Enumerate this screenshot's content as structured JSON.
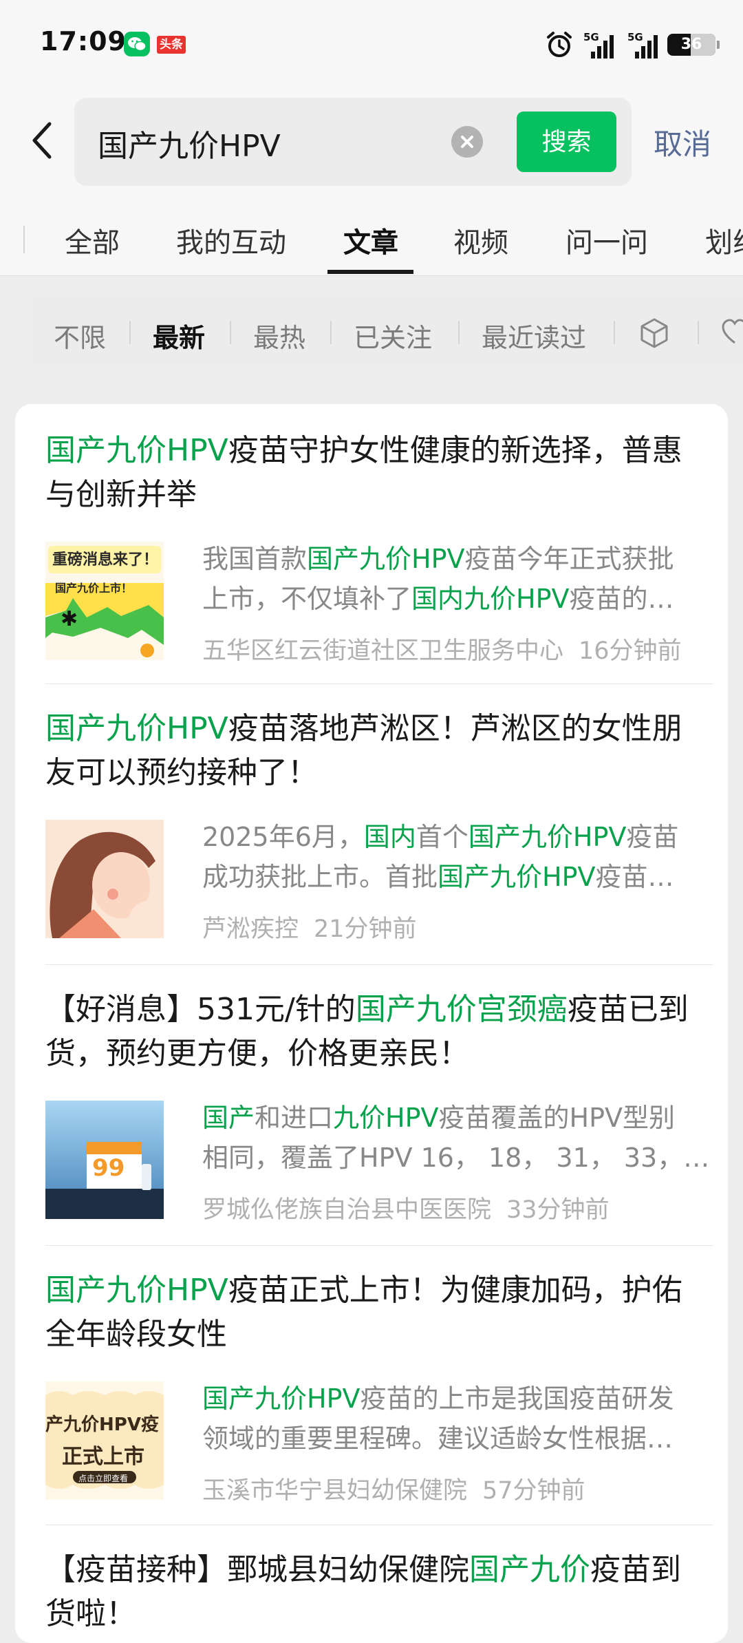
{
  "status_bar": {
    "time": "17:09",
    "toutiao_label": "头条",
    "signal1_label": "5G",
    "signal2_label": "5G",
    "battery": "36",
    "icons": [
      "wechat-icon",
      "toutiao-icon",
      "alarm-icon",
      "signal-icon",
      "battery-icon"
    ]
  },
  "search": {
    "query": "国产九价HPV",
    "search_button": "搜索",
    "cancel": "取消"
  },
  "tabs": {
    "items": [
      "全部",
      "我的互动",
      "文章",
      "视频",
      "问一问",
      "划线"
    ],
    "active": "文章"
  },
  "filters": {
    "items": [
      "不限",
      "最新",
      "最热",
      "已关注",
      "最近读过"
    ],
    "active": "最新",
    "icons": [
      "cube-icon",
      "heart-icon"
    ]
  },
  "results": [
    {
      "title": [
        "国产九价HPV",
        "疫苗守护女性健康的新选择，普惠与创新并举"
      ],
      "snippet_line1": [
        "我国首款",
        "国产九价HPV",
        "疫苗今年正式获批"
      ],
      "snippet_line2": [
        "上市，不仅填补了",
        "国内九价HPV",
        "疫苗的…"
      ],
      "source": "五华区红云街道社区卫生服务中心",
      "time": "16分钟前",
      "thumb_text1": "重磅消息来了！",
      "thumb_text2": "国产九价上市！"
    },
    {
      "title": [
        "国产九价HPV",
        "疫苗落地芦淞区！芦淞区的女性朋友可以预约接种了！"
      ],
      "snippet_line1": [
        "2025年6月，",
        "国内",
        "首个",
        "国产九价HPV",
        "疫苗"
      ],
      "snippet_line2": [
        "成功获批上市。首批",
        "国产九价HPV",
        "疫苗…"
      ],
      "source": "芦淞疾控",
      "time": "21分钟前"
    },
    {
      "title": [
        "【好消息】531元/针的",
        "国产九价宫颈癌",
        "疫苗已到货，预约更方便，价格更亲民！"
      ],
      "snippet_line1": [
        "国产",
        "和进口",
        "九价HPV",
        "疫苗覆盖的HPV型别"
      ],
      "snippet_line2": [
        "相同，覆盖了HPV 16， 18， 31， 33，…"
      ],
      "source": "罗城仫佬族自治县中医医院",
      "time": "33分钟前",
      "thumb_text": "99"
    },
    {
      "title": [
        "国产九价HPV",
        "疫苗正式上市！为健康加码，护佑全年龄段女性"
      ],
      "snippet_line1": [
        "国产九价HPV",
        "疫苗的上市是我国疫苗研发"
      ],
      "snippet_line2": [
        "领域的重要里程碑。建议适龄女性根据…"
      ],
      "source": "玉溪市华宁县妇幼保健院",
      "time": "57分钟前",
      "thumb_text1": "产九价HPV疫",
      "thumb_text2": "正式上市",
      "thumb_text3": "点击立即查看"
    },
    {
      "title": [
        "【疫苗接种】鄄城县妇幼保健院",
        "国产九价",
        "疫苗到货啦！"
      ]
    }
  ]
}
